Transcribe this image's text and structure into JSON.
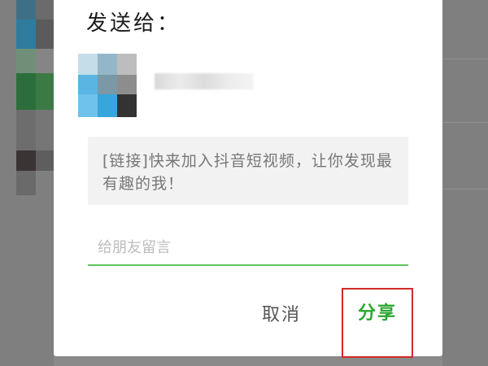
{
  "dialog": {
    "title": "发送给：",
    "recipient": {
      "name": ""
    },
    "link_text": "[链接]快来加入抖音短视频，让你发现最有趣的我！",
    "message_placeholder": "给朋友留言",
    "message_value": "",
    "buttons": {
      "cancel_label": "取消",
      "share_label": "分享"
    }
  },
  "colors": {
    "accent": "#2aa62d",
    "underline": "#62c25a",
    "highlight_border": "#d22a2a"
  }
}
